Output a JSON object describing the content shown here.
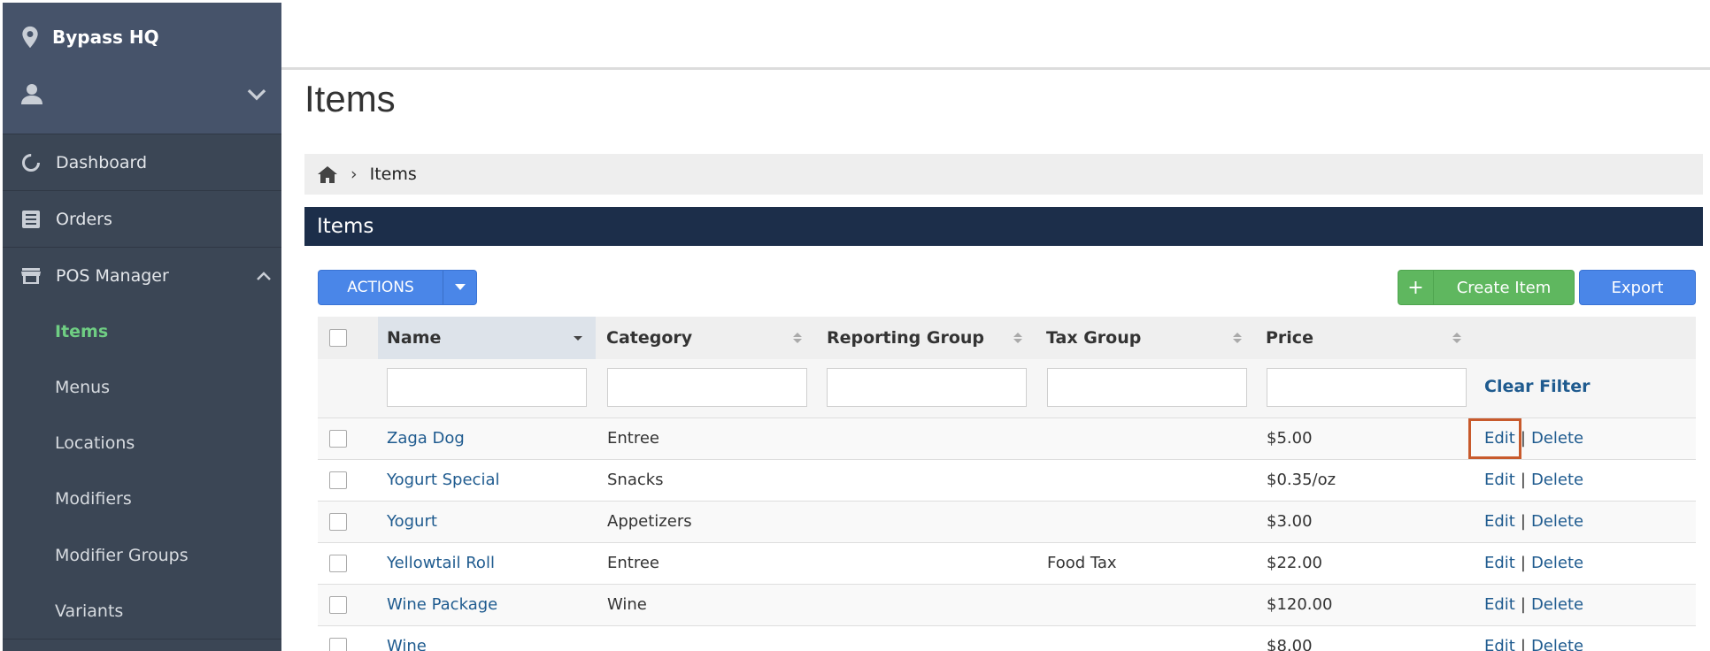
{
  "sidebar": {
    "location": "Bypass HQ",
    "nav": [
      {
        "label": "Dashboard",
        "icon": "dashboard-icon"
      },
      {
        "label": "Orders",
        "icon": "orders-icon"
      },
      {
        "label": "POS Manager",
        "icon": "store-icon"
      }
    ],
    "sub_items": [
      "Items",
      "Menus",
      "Locations",
      "Modifiers",
      "Modifier Groups",
      "Variants"
    ],
    "active_sub": "Items"
  },
  "page": {
    "title": "Items",
    "breadcrumb": "Items",
    "panel_title": "Items"
  },
  "toolbar": {
    "actions_label": "ACTIONS",
    "create_label": "Create Item",
    "create_plus": "+",
    "export_label": "Export"
  },
  "table": {
    "columns": [
      "Name",
      "Category",
      "Reporting Group",
      "Tax Group",
      "Price"
    ],
    "clear_filter": "Clear Filter",
    "edit_label": "Edit",
    "delete_label": "Delete",
    "rows": [
      {
        "name": "Zaga Dog",
        "category": "Entree",
        "reporting_group": "",
        "tax_group": "",
        "price": "$5.00"
      },
      {
        "name": "Yogurt Special",
        "category": "Snacks",
        "reporting_group": "",
        "tax_group": "",
        "price": "$0.35/oz"
      },
      {
        "name": "Yogurt",
        "category": "Appetizers",
        "reporting_group": "",
        "tax_group": "",
        "price": "$3.00"
      },
      {
        "name": "Yellowtail Roll",
        "category": "Entree",
        "reporting_group": "",
        "tax_group": "Food Tax",
        "price": "$22.00"
      },
      {
        "name": "Wine Package",
        "category": "Wine",
        "reporting_group": "",
        "tax_group": "",
        "price": "$120.00"
      },
      {
        "name": "Wine",
        "category": "",
        "reporting_group": "",
        "tax_group": "",
        "price": "$8.00"
      }
    ]
  },
  "colors": {
    "sidebar": "#3b4655",
    "active": "#6fce83",
    "panel_header": "#1c2e4a",
    "primary_button": "#4a86e8",
    "create_button": "#5fb75f",
    "link": "#1f5b8f",
    "highlight": "#c85a2c"
  }
}
